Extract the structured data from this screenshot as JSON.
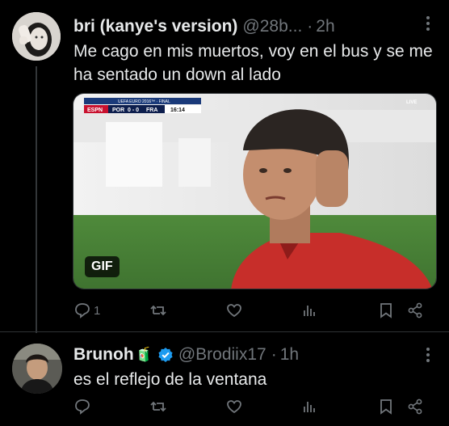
{
  "tweets": [
    {
      "name": "bri (kanye's version)",
      "handle": "@28b...",
      "separator": "·",
      "time": "2h",
      "text": "Me cago en mis muertos, voy en el bus y se me ha sentado un down al lado",
      "media": {
        "type": "gif",
        "badge": "GIF",
        "scorebug": {
          "network": "ESPN",
          "competition": "UEFA EURO 2016™ · FINAL",
          "team_home": "POR",
          "score": "0 - 0",
          "team_away": "FRA",
          "clock": "16:14"
        },
        "live_tag": "LIVE"
      },
      "actions": {
        "reply_count": "1",
        "retweet_count": "",
        "like_count": "",
        "views_count": ""
      }
    },
    {
      "name": "Brunoh",
      "name_emoji": "🧃",
      "verified": true,
      "handle": "@Brodiix17",
      "separator": "·",
      "time": "1h",
      "text": "es el reflejo de la ventana",
      "actions": {
        "reply_count": "",
        "retweet_count": "",
        "like_count": "",
        "views_count": ""
      }
    }
  ],
  "icons": [
    "more-icon",
    "reply-icon",
    "retweet-icon",
    "like-icon",
    "views-icon",
    "bookmark-icon",
    "share-icon",
    "verified-badge-icon"
  ],
  "colors": {
    "background": "#000000",
    "text": "#e7e9ea",
    "muted": "#71767b",
    "verified": "#1d9bf0",
    "divider": "#2f3336"
  }
}
